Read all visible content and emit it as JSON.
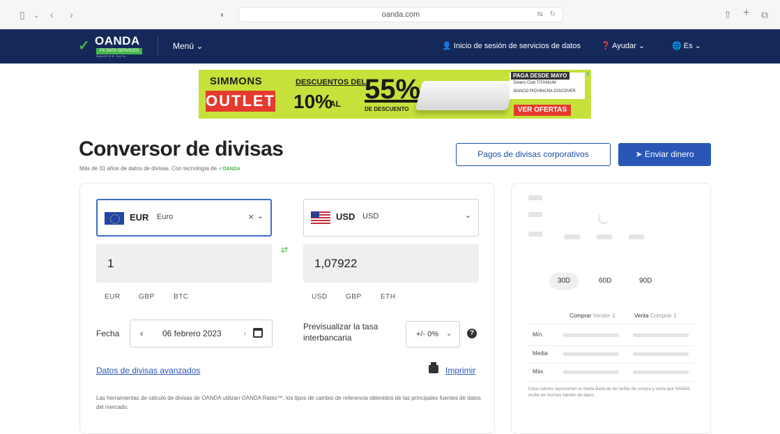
{
  "browser": {
    "url": "oanda.com",
    "icons": [
      "sidebar-icon",
      "chevron-down-icon",
      "back-icon",
      "forward-icon",
      "shield-icon",
      "translate-icon",
      "reload-icon",
      "share-icon",
      "new-tab-icon",
      "tabs-icon"
    ]
  },
  "nav": {
    "logo_word": "OANDA",
    "logo_tag": "FX DATA SERVICES",
    "logo_tag2": "SMARTER DATA",
    "menu": "Menú",
    "login": "Inicio de sesión de servicios de datos",
    "help": "Ayudar",
    "lang": "Es",
    "color": "#14285a"
  },
  "ad": {
    "brand": "SIMMONS",
    "outlet": "OUTLET",
    "desc": "DESCUENTOS DEL",
    "pct10": "10%",
    "al": "AL",
    "pct55": "55%",
    "dd": "DE DESCUENTO",
    "paga": "PAGA DESDE MAYO",
    "bank1": "Diners Club  TITANIUM",
    "bank2": "BANCO PICHINCHA  DISCOVER",
    "cta": "VER OFERTAS",
    "close": "X"
  },
  "header": {
    "title": "Conversor de divisas",
    "subtitle": "Más de 31 años de datos de divisas. Con tecnología de",
    "subtitle_logo": "OANDA",
    "btn_corp": "Pagos de divisas corporativos",
    "btn_send": "Enviar dinero"
  },
  "converter": {
    "from": {
      "code": "EUR",
      "name": "Euro",
      "amount": "1",
      "quick": [
        "EUR",
        "GBP",
        "BTC"
      ]
    },
    "to": {
      "code": "USD",
      "name": "USD",
      "amount": "1,07922",
      "quick": [
        "USD",
        "GBP",
        "ETH"
      ]
    },
    "date_label": "Fecha",
    "date": "06 febrero 2023",
    "preview_label": "Previsualizar la tasa interbancaria",
    "tolerance": "+/- 0%",
    "advanced": "Datos de divisas avanzados",
    "print": "Imprimir",
    "disclaimer": "Las herramientas de cálculo de divisas de OANDA utilizan OANDA Rates™, los tipos de cambio de referencia obtenidos de las principales fuentes de datos del mercado.",
    "accent": "#2a56b7"
  },
  "side": {
    "ranges": [
      "30D",
      "60D",
      "90D"
    ],
    "buy_label": "Comprar",
    "sell1": "Vender 1",
    "sell_label": "Venta",
    "buy1": "Comprar 1",
    "rows": [
      "Mín.",
      "Media",
      "Máx."
    ],
    "footnote": "Estos valores representan la media diaria de las tarifas de compra y venta que OANDA recibe de muchas fuentes de datos."
  }
}
